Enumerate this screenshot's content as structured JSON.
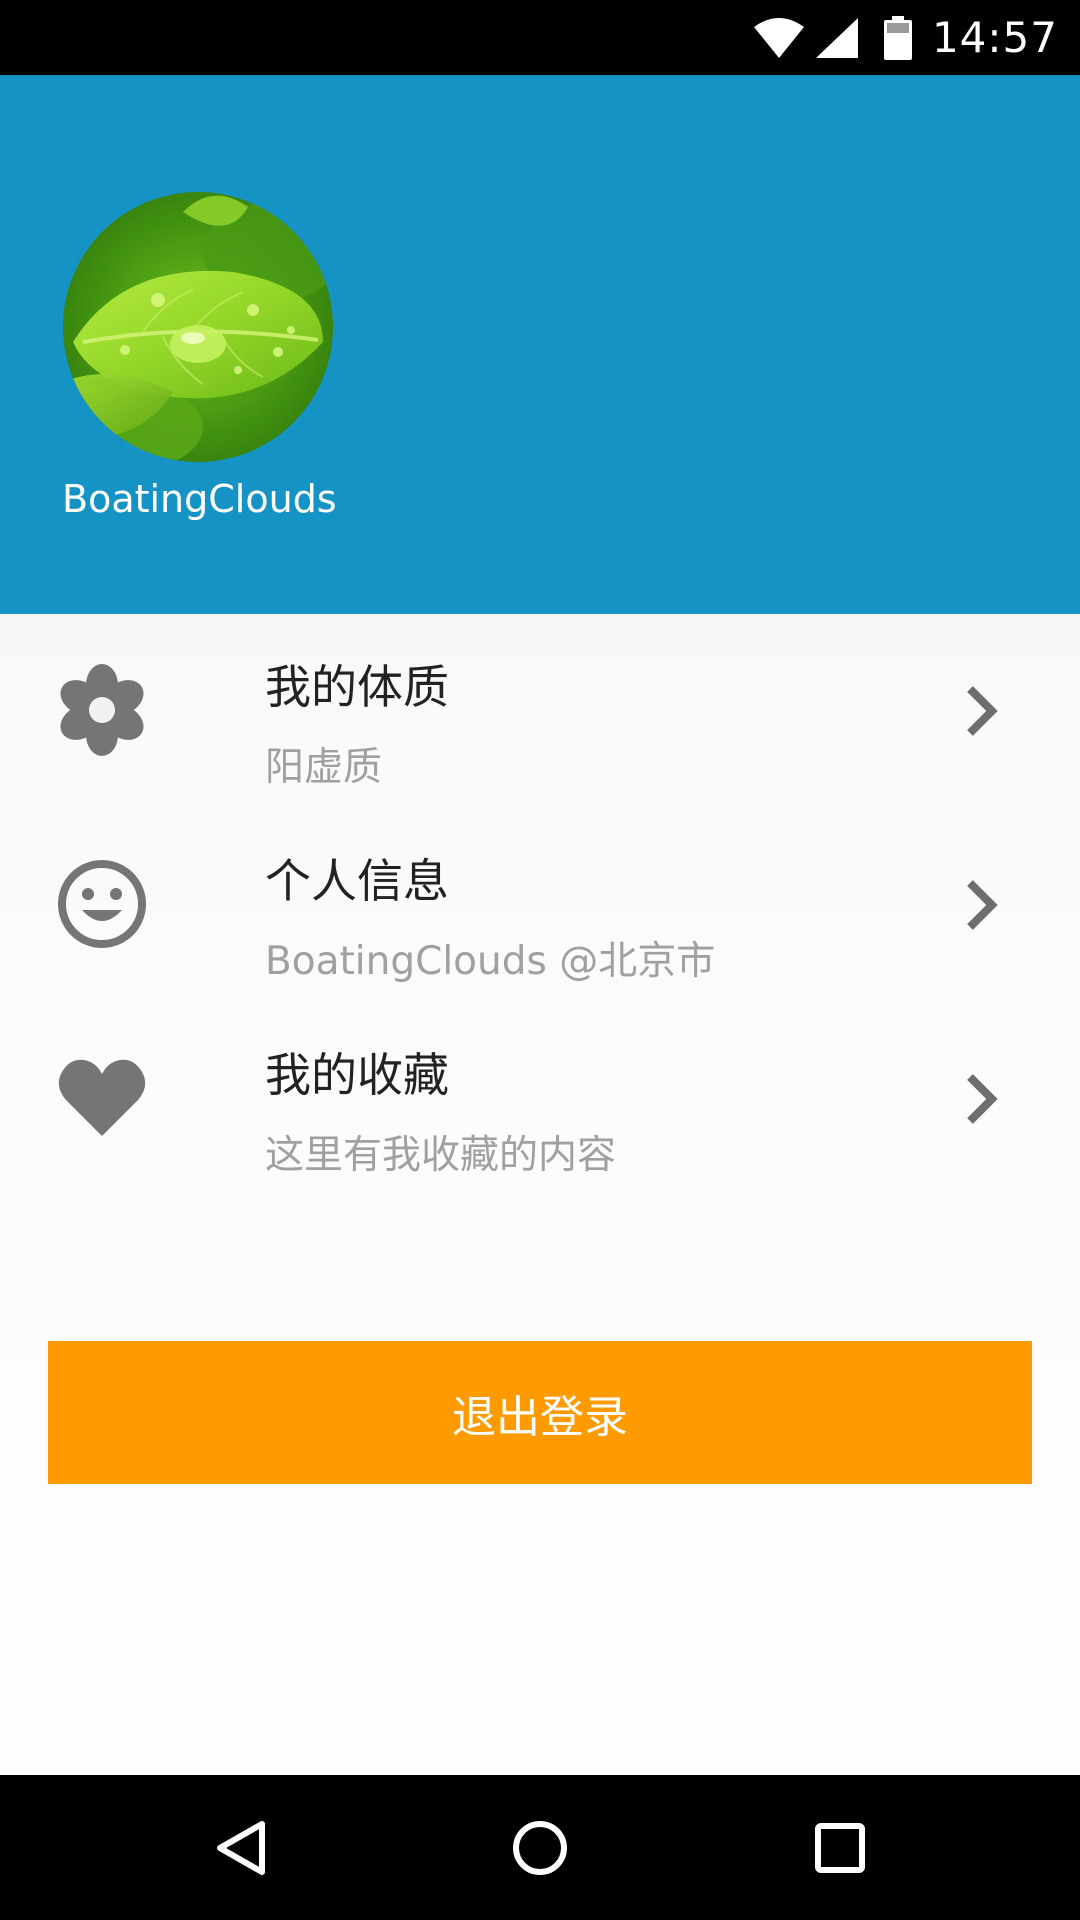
{
  "status_bar": {
    "time": "14:57",
    "icons": [
      "wifi-icon",
      "signal-icon",
      "battery-icon"
    ]
  },
  "profile": {
    "username": "BoatingClouds",
    "avatar": "leaf-photo"
  },
  "menu": {
    "items": [
      {
        "icon": "flower-icon",
        "title": "我的体质",
        "subtitle": "阳虚质"
      },
      {
        "icon": "smiley-icon",
        "title": "个人信息",
        "subtitle": "BoatingClouds @北京市"
      },
      {
        "icon": "heart-icon",
        "title": "我的收藏",
        "subtitle": "这里有我收藏的内容"
      }
    ]
  },
  "logout": {
    "label": "退出登录"
  },
  "nav": {
    "buttons": [
      "back-icon",
      "home-icon",
      "recents-icon"
    ]
  },
  "colors": {
    "header": "#1693c5",
    "accent": "#ff9b00",
    "icon": "#757575",
    "chevron": "#6e6e6e"
  }
}
